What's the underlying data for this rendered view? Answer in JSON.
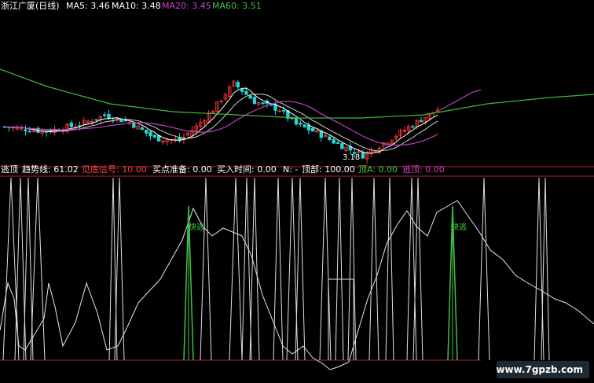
{
  "top_bar": {
    "stock_name": "浙江广厦(日线)",
    "ma_items": [
      {
        "label": "MA5: 3.46",
        "color": "#ffffff"
      },
      {
        "label": "MA10: 3.48",
        "color": "#ffffff"
      },
      {
        "label": "MA20: 3.45",
        "color": "#d040d0"
      },
      {
        "label": "MA60: 3.51",
        "color": "#40c040"
      }
    ]
  },
  "price_panel": {
    "low_marker": "3.18",
    "colors": {
      "up": "#ff3b3b",
      "down": "#26d4d4",
      "ma5": "#ffffff",
      "ma10": "#d0d0d0",
      "ma20": "#c040c0",
      "ma60": "#3cb83c"
    }
  },
  "indicator_bar": {
    "items": [
      {
        "text": "逃顶",
        "color": "#ffffff"
      },
      {
        "text": "趋势线: 61.02",
        "color": "#ffffff"
      },
      {
        "text": "见底信号: 10.00",
        "color": "#ff4040"
      },
      {
        "text": "买点准备: 0.00",
        "color": "#ffffff"
      },
      {
        "text": "买入时间: 0.00",
        "color": "#ffffff"
      },
      {
        "text": "N: -",
        "color": "#ffffff"
      },
      {
        "text": "顶部: 100.00",
        "color": "#ffffff"
      },
      {
        "text": "顶A: 0.00",
        "color": "#40d040"
      },
      {
        "text": "逃顶: 0.00",
        "color": "#d040d0"
      }
    ]
  },
  "signals": {
    "fast_escape": "快逃"
  },
  "watermark": "www.7gpzb.com"
}
